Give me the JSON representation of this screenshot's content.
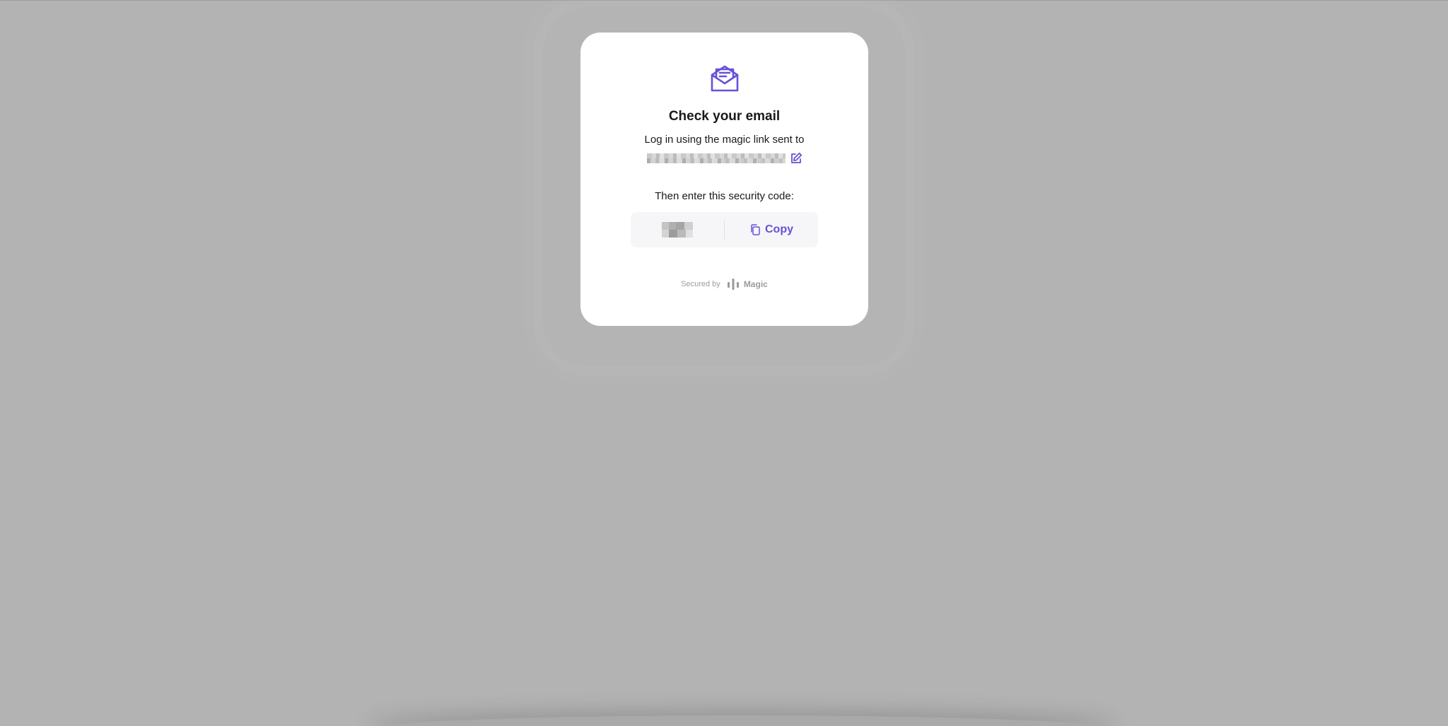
{
  "dialog": {
    "title": "Check your email",
    "description": "Log in using the magic link sent to",
    "then_text": "Then enter this security code:",
    "copy_label": "Copy"
  },
  "footer": {
    "secured_by": "Secured by",
    "brand": "Magic"
  },
  "colors": {
    "accent": "#6851d6",
    "backdrop": "#b3b3b3",
    "modal_bg": "#ffffff",
    "code_bg": "#f6f6f8"
  },
  "icons": {
    "header": "open-envelope-icon",
    "edit": "edit-icon",
    "copy": "copy-icon",
    "brand": "magic-logo-icon"
  }
}
